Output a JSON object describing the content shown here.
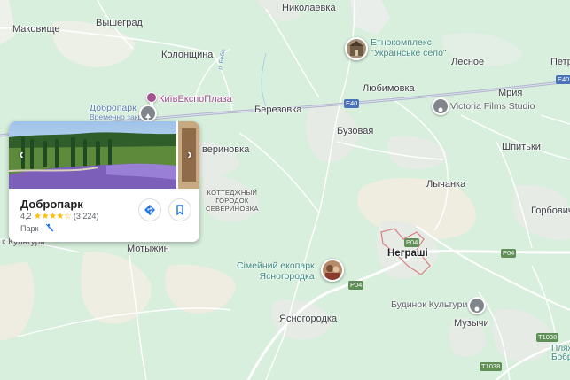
{
  "labels": {
    "makovysche": "Маковище",
    "vyshegrad": "Вышеград",
    "mykolaivka": "Николаевка",
    "kolonshchyna": "Колонщина",
    "etno": "Етнокомплекс",
    "etno2": "\"Українське село\"",
    "lesnoe": "Лесное",
    "petr": "Петр",
    "dobropark_map": "Добропарк",
    "dobropark_closed": "Временно закрыто",
    "kyivexpoplaza": "КиївЕкспоПлаза",
    "river_label": "р. Бобіс",
    "lyubimovka": "Любимовка",
    "mriya": "Мрия",
    "berezovka": "Березовка",
    "victoria": "Victoria Films Studio",
    "buzovaya": "Бузовая",
    "shpytky": "Шпитьки",
    "severynivka": "вериновка",
    "lychanka": "Лычанка",
    "cottage1": "КОТТЕДЖНЫЙ",
    "cottage2": "ГОРОДОК",
    "cottage3": "СЕВЕРИНОВКА",
    "gorbovychi": "Горбовичі",
    "negrashi": "Неграші",
    "culture_left": "к Культури",
    "motyzhyn": "Мотыжин",
    "ekopark1": "Сімейний екопарк",
    "ekopark2": "Ясногородка",
    "budynok": "Будинок Культури",
    "yasnogorodka": "Ясногородка",
    "muzychi": "Музычи",
    "plyazh1": "Пляж",
    "plyazh2": "Бобриц"
  },
  "roads": {
    "e40_a": "E40",
    "e40_b": "E40",
    "p04_a": "P04",
    "p04_b": "P04",
    "p04_c": "P04",
    "t1038_a": "T1038",
    "t1038_b": "T1038"
  },
  "card": {
    "title": "Добропарк",
    "rating": "4,2",
    "stars": "★★★★☆",
    "reviews": "(3 224)",
    "type": "Парк ·",
    "rating_value": 4.2
  },
  "colors": {
    "land": "#d7efdc",
    "urban": "#e9eeea",
    "water_green": "#c3e6cc",
    "field": "#f1ece2",
    "road": "#ffffff",
    "highway": "#9aa0c4",
    "boundary": "#c96a6a",
    "star": "#fbbc04",
    "accent": "#1a73e8"
  }
}
